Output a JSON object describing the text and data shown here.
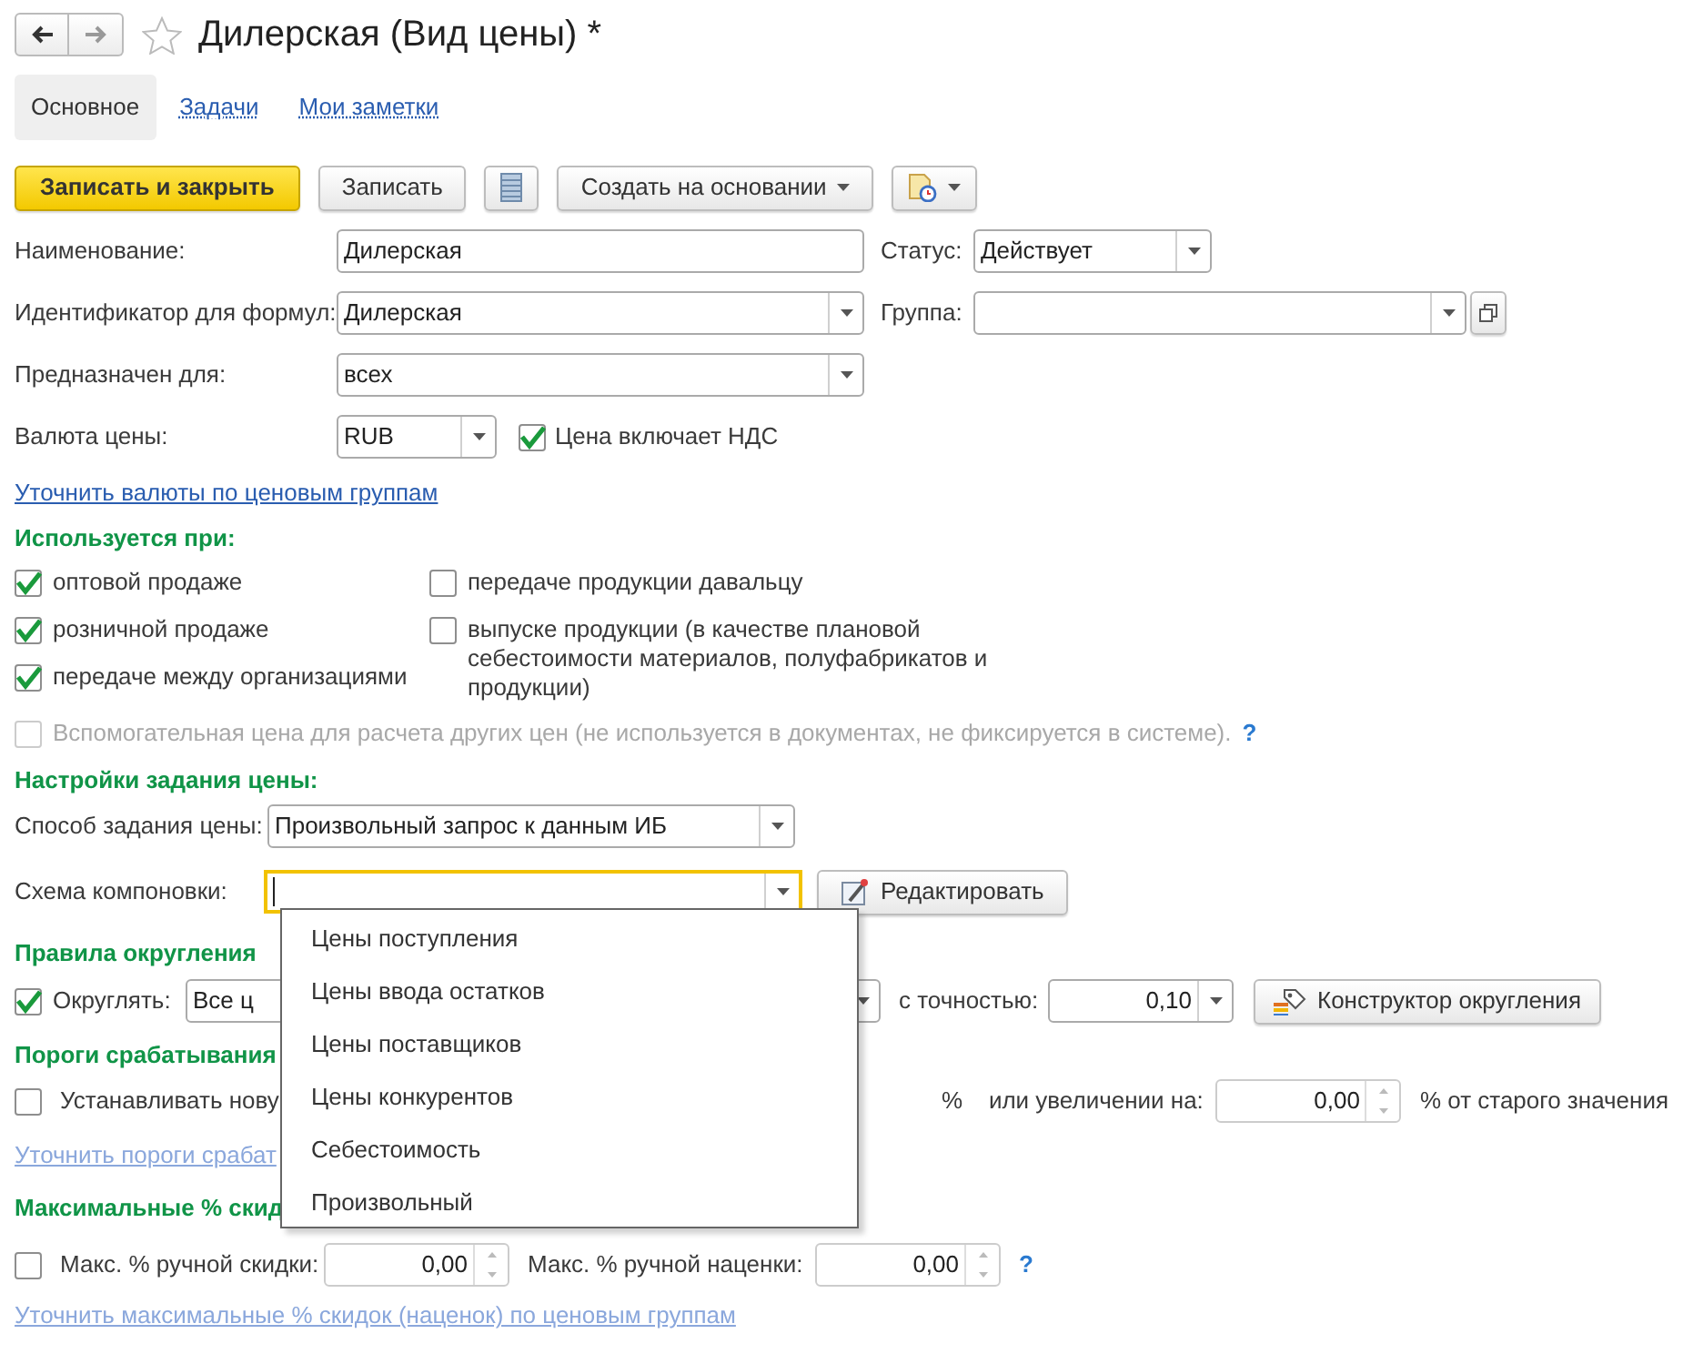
{
  "title": "Дилерская (Вид цены) *",
  "favorite": false,
  "tabs": [
    {
      "label": "Основное",
      "selected": true
    },
    {
      "label": "Задачи",
      "selected": false
    },
    {
      "label": "Мои заметки",
      "selected": false
    }
  ],
  "toolbar": [
    {
      "kind": "primary",
      "label": "Записать и закрыть"
    },
    {
      "kind": "button",
      "label": "Записать"
    },
    {
      "kind": "list-icon"
    },
    {
      "kind": "menu",
      "label": "Создать на основании"
    },
    {
      "kind": "doc-menu"
    }
  ],
  "main_fields": [
    {
      "label": "Наименование:",
      "value": "Дилерская",
      "kind": "text",
      "side": {
        "label": "Статус:",
        "value": "Действует",
        "kind": "select"
      }
    },
    {
      "label": "Идентификатор для формул:",
      "value": "Дилерская",
      "kind": "select",
      "side": {
        "label": "Группа:",
        "kind": "select-open"
      }
    },
    {
      "label": "Предназначен для:",
      "value": "всех",
      "kind": "select"
    },
    {
      "label": "Валюта цены:",
      "value": "RUB",
      "kind": "select-short",
      "checkbox": {
        "label": "Цена включает НДС",
        "checked": true
      }
    }
  ],
  "currency_link": "Уточнить валюты по ценовым группам",
  "usage": {
    "title": "Используется при:",
    "left": [
      {
        "label": "оптовой продаже",
        "checked": true
      },
      {
        "label": "розничной продаже",
        "checked": true
      },
      {
        "label": "передаче между организациями",
        "checked": true
      }
    ],
    "right": [
      {
        "label": "передаче продукции давальцу",
        "checked": false
      },
      {
        "label": "выпуске продукции (в качестве плановой себестоимости материалов, полуфабрикатов и продукции)",
        "checked": false
      }
    ]
  },
  "auxiliary": {
    "label": "Вспомогательная цена для расчета других цен (не используется в документах, не фиксируется в системе).",
    "checked": false,
    "disabled": true,
    "help": "?"
  },
  "price_settings": {
    "title": "Настройки задания цены:",
    "method_label": "Способ задания цены:",
    "method": "Произвольный запрос к данным ИБ",
    "schema_label": "Схема компоновки:",
    "schema_focused": true,
    "edit_button": "Редактировать"
  },
  "rounding": {
    "title": "Правила округления",
    "checked": true,
    "label": "Округлять:",
    "value": "Все ц",
    "precision_label": "с точностью:",
    "precision": "0,10",
    "button": "Конструктор округления"
  },
  "thresholds": {
    "title": "Пороги срабатывания",
    "checked": false,
    "label": "Устанавливать нову",
    "percent": "%",
    "increase_label": "или увеличении на:",
    "increase": "0,00",
    "suffix": "% от старого значения",
    "link": "Уточнить пороги срабат",
    "link_disabled": true
  },
  "max_discounts": {
    "title": "Максимальные % скид",
    "checked": false,
    "discount_label": "Макс. % ручной скидки:",
    "discount": "0,00",
    "markup_label": "Макс. % ручной наценки:",
    "markup": "0,00",
    "help": "?",
    "link": "Уточнить максимальные % скидок (наценок) по ценовым группам",
    "link_disabled": true
  },
  "dropdown": {
    "items": [
      "Цены поступления",
      "Цены ввода остатков",
      "Цены поставщиков",
      "Цены конкурентов",
      "Себестоимость",
      "Произвольный"
    ]
  }
}
